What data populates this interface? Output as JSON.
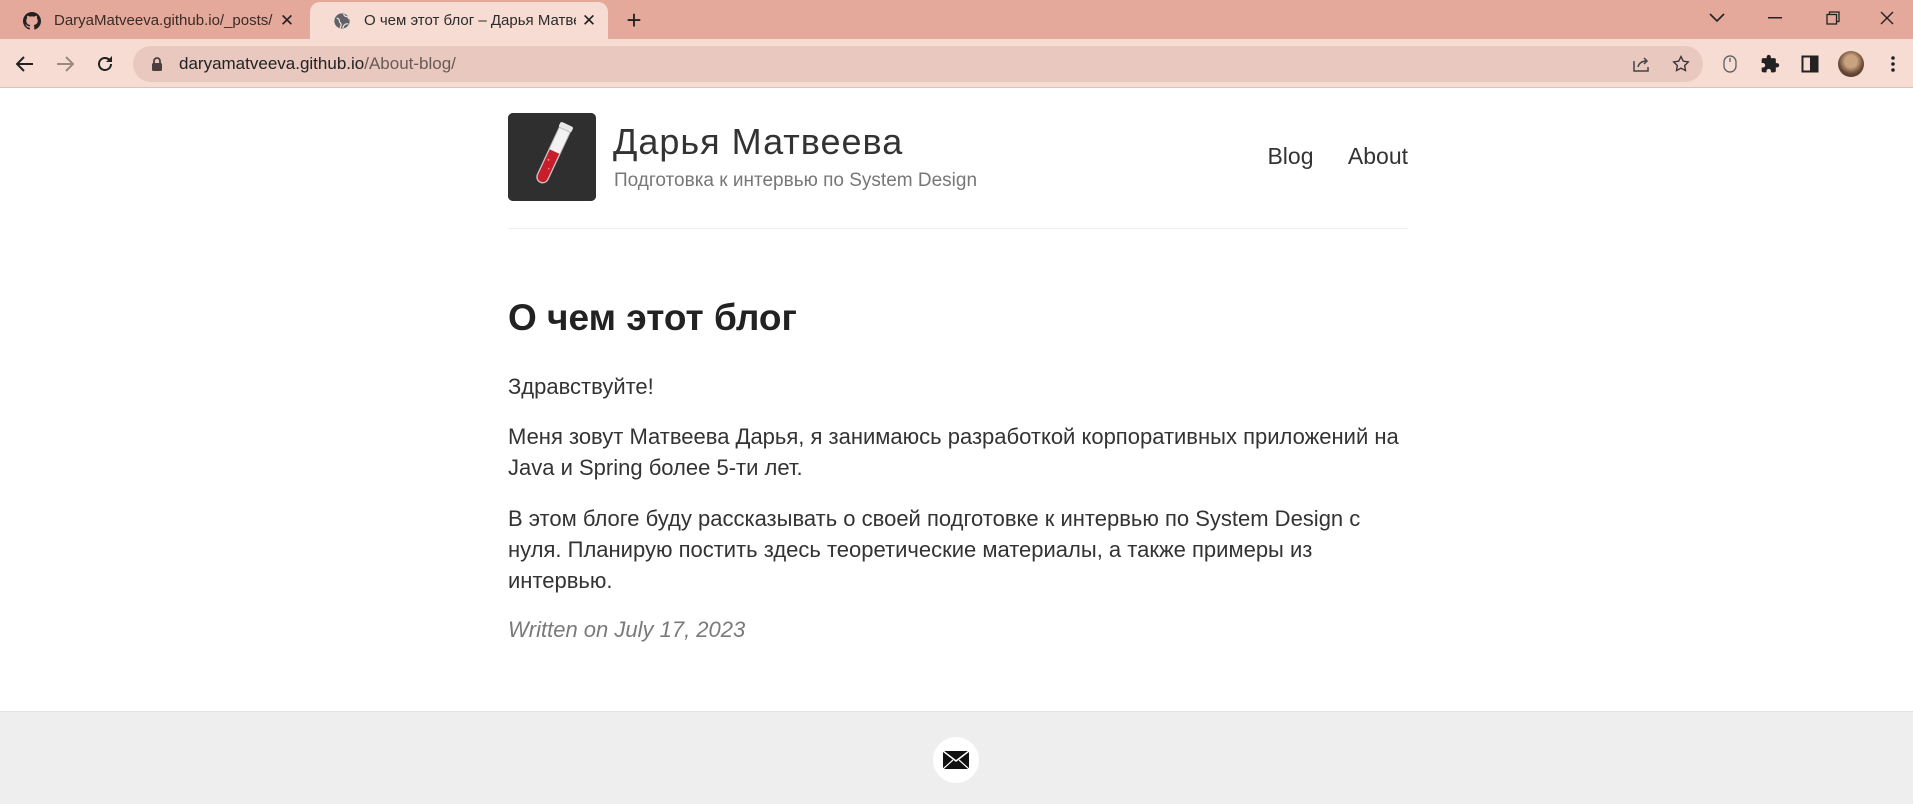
{
  "browser": {
    "tabs": [
      {
        "title": "DaryaMatveeva.github.io/_posts/",
        "icon": "github-icon",
        "active": false
      },
      {
        "title": "О чем этот блог – Дарья Матвеева",
        "icon": "globe-icon",
        "active": true
      }
    ],
    "url": {
      "host": "daryamatveeva.github.io",
      "path": "/About-blog/"
    }
  },
  "site": {
    "name": "Дарья Матвеева",
    "description": "Подготовка к интервью по System Design",
    "nav": [
      "Blog",
      "About"
    ]
  },
  "post": {
    "title": "О чем этот блог",
    "paragraphs": [
      "Здравствуйте!",
      "Меня зовут Матвеева Дарья, я занимаюсь разработкой корпоративных приложений на Java и Spring более 5-ти лет.",
      "В этом блоге буду рассказывать о своей подготовке к интервью по System Design с нуля. Планирую постить здесь теоретические материалы, а также примеры из интервью."
    ],
    "date_line": "Written on July 17, 2023"
  },
  "footer": {
    "icons": [
      "mail-icon"
    ]
  },
  "colors": {
    "tabstrip": "#e4a99a",
    "toolbar": "#f7dcd3",
    "omnibox": "#e8c8bf",
    "footer": "#eeeeee"
  }
}
